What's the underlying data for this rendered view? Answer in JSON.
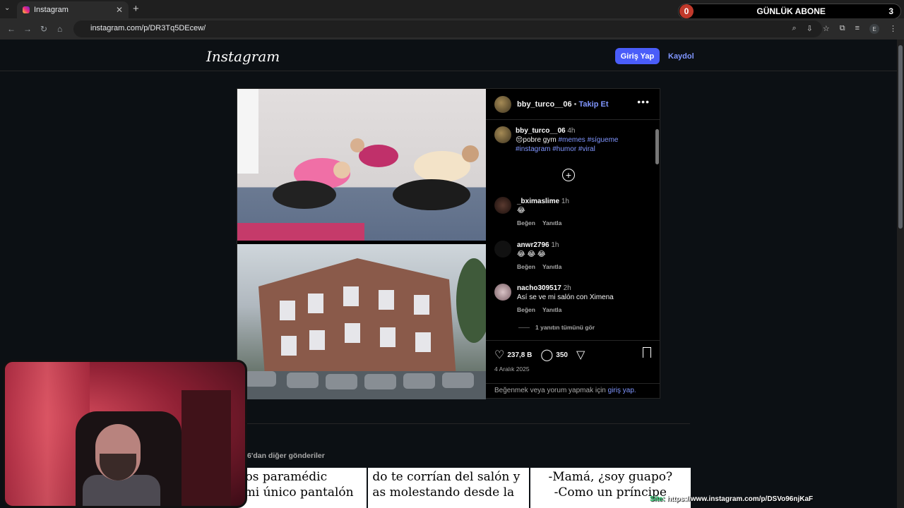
{
  "browser": {
    "tab_title": "Instagram",
    "tab_close": "✕",
    "new_tab": "+",
    "url": "instagram.com/p/DR3Tq5DEcew/",
    "profile_initial": "E"
  },
  "subscriber_widget": {
    "left_count": "0",
    "title": "GÜNLÜK ABONE",
    "right_count": "3"
  },
  "header": {
    "logo": "Instagram",
    "login_label": "Giriş Yap",
    "signup_label": "Kaydol"
  },
  "post": {
    "username": "bby_turco__06",
    "follow_label": "Takip Et",
    "caption": {
      "username": "bby_turco__06",
      "time": "4h",
      "text": "😔pobre gym",
      "tags": "#memes #sígueme #instagram #humor #viral"
    },
    "comments": [
      {
        "username": "_bximaslime",
        "time": "1h",
        "text": "😂",
        "like": "Beğen",
        "reply": "Yanıtla"
      },
      {
        "username": "anwr2796",
        "time": "1h",
        "text": "😂 😂 😂",
        "like": "Beğen",
        "reply": "Yanıtla"
      },
      {
        "username": "nacho309517",
        "time": "2h",
        "text": "Así se ve mi salón con Ximena",
        "like": "Beğen",
        "reply": "Yanıtla"
      }
    ],
    "view_replies": "1 yanıtın tümünü gör",
    "likes": "237,8 B",
    "comment_count": "350",
    "date": "4 Aralık 2025",
    "login_prompt": "Beğenmek veya yorum yapmak için",
    "login_link": "giriş yap."
  },
  "more_posts": {
    "label": "6'dan diğer gönderiler"
  },
  "grid_texts": [
    {
      "line1": "l ver los paramédic",
      "line2": "ando mi único pantalón"
    },
    {
      "line1": "do te corrían del salón y",
      "line2": "as molestando desde la"
    },
    {
      "line1": "-Mamá, ¿soy guapo?",
      "line2": "-Como un príncipe"
    }
  ],
  "overlay": {
    "prefix": "Site:",
    "url": "https://www.instagram.com/p/DSVo96njKaF"
  }
}
